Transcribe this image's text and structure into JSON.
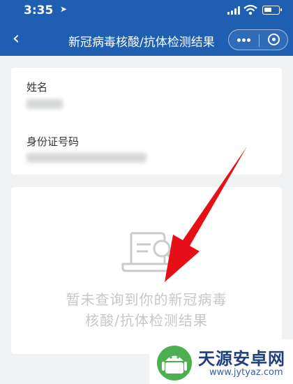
{
  "status_bar": {
    "time": "3:35"
  },
  "nav": {
    "title": "新冠病毒核酸/抗体检测结果"
  },
  "form": {
    "name_label": "姓名",
    "id_label": "身份证号码"
  },
  "result": {
    "empty_line1": "暂未查询到你的新冠病毒",
    "empty_line2": "核酸/抗体检测结果"
  },
  "watermark": {
    "title": "天源安卓网",
    "url": "www.jytyaz.com"
  },
  "colors": {
    "brand": "#1f5fb1",
    "arrow": "#e60f18",
    "empty_text": "#c6c7c9"
  },
  "icons": [
    "back-arrow-icon",
    "location-arrow-icon",
    "signal-icon",
    "wifi-icon",
    "battery-icon",
    "more-dots-icon",
    "target-icon",
    "document-search-icon",
    "android-logo-icon"
  ]
}
